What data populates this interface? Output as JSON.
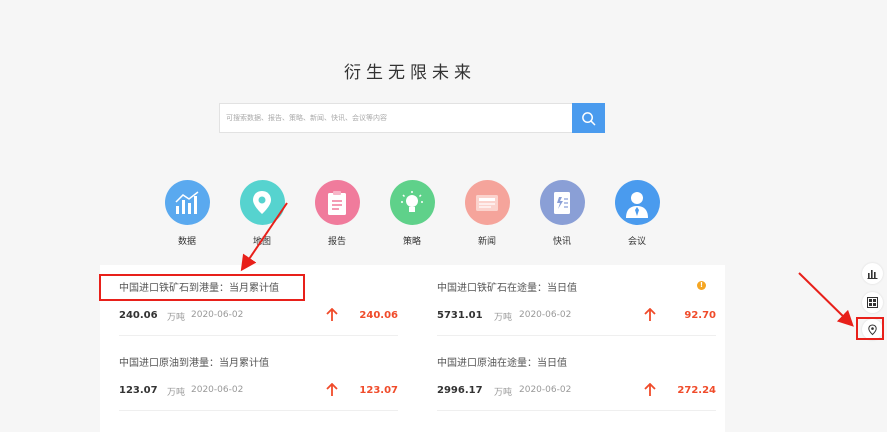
{
  "title": "衍生无限未来",
  "search": {
    "placeholder": "可搜索数据、报告、策略、新闻、快讯、会议等内容"
  },
  "categories": [
    {
      "label": "数据",
      "icon": "chart-bars-icon",
      "color": "#5aa9ef"
    },
    {
      "label": "地图",
      "icon": "map-pin-icon",
      "color": "#56d3cf"
    },
    {
      "label": "报告",
      "icon": "report-doc-icon",
      "color": "#f07b9c"
    },
    {
      "label": "策略",
      "icon": "lightbulb-icon",
      "color": "#5fd18a"
    },
    {
      "label": "新闻",
      "icon": "newspaper-icon",
      "color": "#f5a49b"
    },
    {
      "label": "快讯",
      "icon": "flash-doc-icon",
      "color": "#8a9fd6"
    },
    {
      "label": "会议",
      "icon": "person-icon",
      "color": "#4a9bee"
    }
  ],
  "items": [
    {
      "name": "中国进口铁矿石到港量：当月累计值",
      "value": "240.06",
      "unit": "万吨",
      "date": "2020-06-02",
      "change": "240.06"
    },
    {
      "name": "中国进口铁矿石在途量：当日值",
      "value": "5731.01",
      "unit": "万吨",
      "date": "2020-06-02",
      "change": "92.70"
    },
    {
      "name": "中国进口原油到港量：当月累计值",
      "value": "123.07",
      "unit": "万吨",
      "date": "2020-06-02",
      "change": "123.07"
    },
    {
      "name": "中国进口原油在途量：当日值",
      "value": "2996.17",
      "unit": "万吨",
      "date": "2020-06-02",
      "change": "272.24"
    }
  ],
  "info_dot": "!",
  "colors": {
    "accent": "#4a9bee",
    "up": "#f04b2a",
    "annotation": "#e8201a"
  },
  "sidebar": [
    "bar-chart-icon",
    "dashboard-icon",
    "map-pin-icon"
  ]
}
